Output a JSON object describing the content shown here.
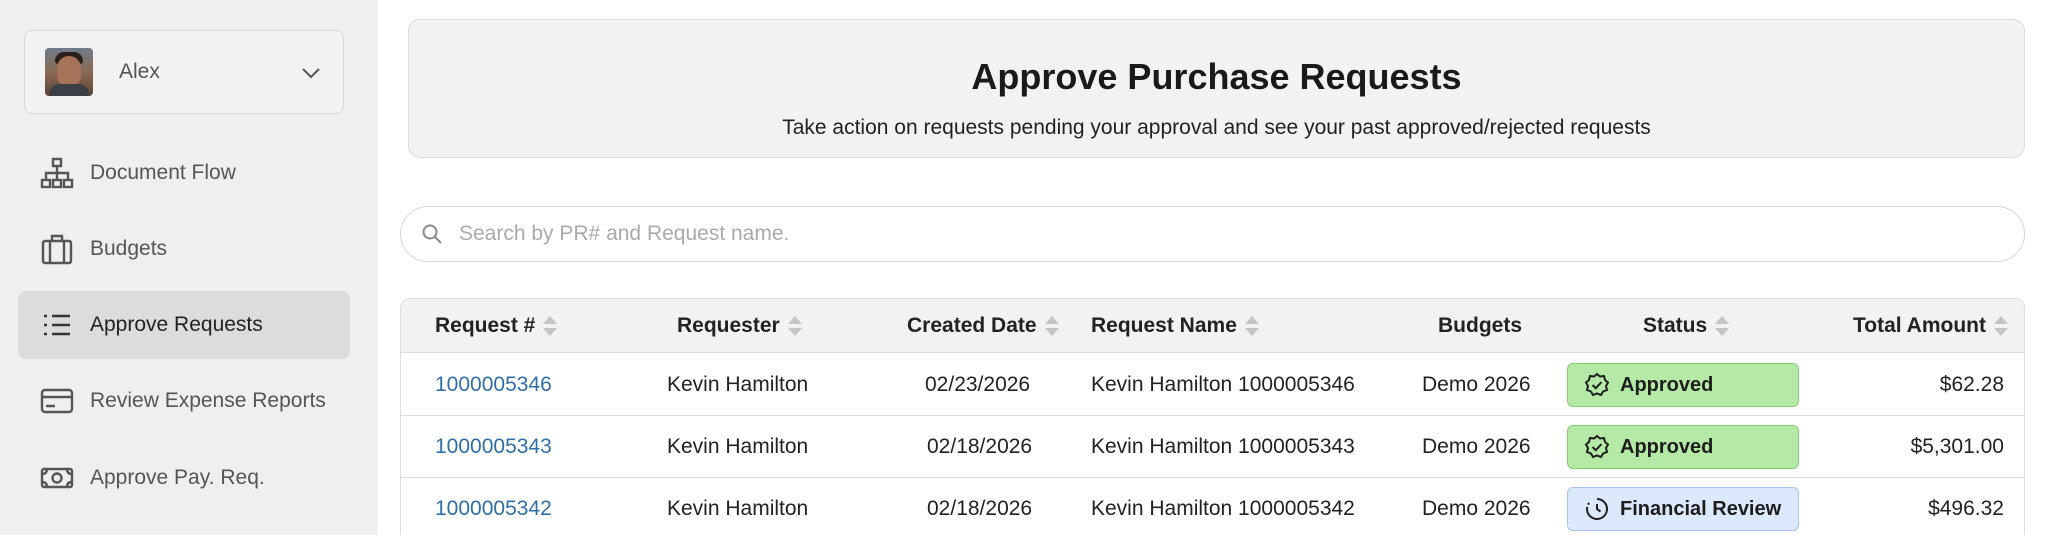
{
  "user": {
    "name": "Alex"
  },
  "nav": [
    {
      "label": "Document Flow",
      "icon": "org-chart-icon"
    },
    {
      "label": "Budgets",
      "icon": "briefcase-icon"
    },
    {
      "label": "Approve Requests",
      "icon": "list-icon",
      "active": true
    },
    {
      "label": "Review Expense Reports",
      "icon": "credit-card-icon"
    },
    {
      "label": "Approve Pay. Req.",
      "icon": "money-icon"
    }
  ],
  "header": {
    "title": "Approve Purchase Requests",
    "subtitle": "Take action on requests pending your approval and see your past approved/rejected requests"
  },
  "search": {
    "placeholder": "Search by PR# and Request name."
  },
  "table": {
    "columns": {
      "request": "Request #",
      "requester": "Requester",
      "created": "Created Date",
      "name": "Request Name",
      "budgets": "Budgets",
      "status": "Status",
      "amount": "Total Amount"
    },
    "rows": [
      {
        "request": "1000005346",
        "requester": "Kevin Hamilton",
        "created": "02/23/2026",
        "name": "Kevin Hamilton 1000005346",
        "budgets": "Demo 2026",
        "status": "Approved",
        "amount": "$62.28"
      },
      {
        "request": "1000005343",
        "requester": "Kevin Hamilton",
        "created": "02/18/2026",
        "name": "Kevin Hamilton 1000005343",
        "budgets": "Demo 2026",
        "status": "Approved",
        "amount": "$5,301.00"
      },
      {
        "request": "1000005342",
        "requester": "Kevin Hamilton",
        "created": "02/18/2026",
        "name": "Kevin Hamilton 1000005342",
        "budgets": "Demo 2026",
        "status": "Financial Review",
        "amount": "$496.32"
      }
    ]
  },
  "colors": {
    "link": "#2f6ea8",
    "approved_bg": "#b4eaa6",
    "review_bg": "#dce8fb",
    "sidebar_bg": "#efefef"
  }
}
